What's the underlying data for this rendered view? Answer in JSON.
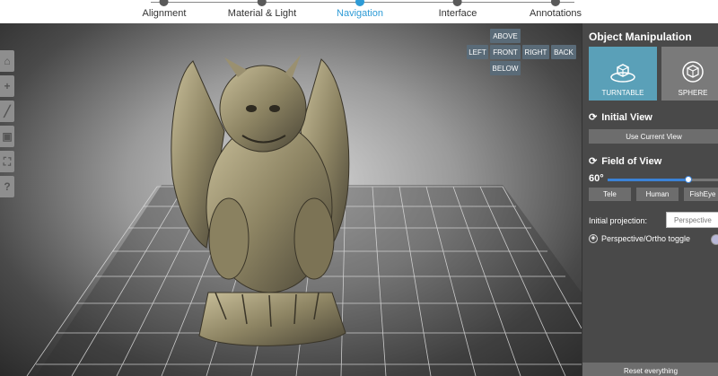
{
  "stepper": {
    "steps": [
      {
        "label": "Alignment"
      },
      {
        "label": "Material & Light"
      },
      {
        "label": "Navigation"
      },
      {
        "label": "Interface"
      },
      {
        "label": "Annotations"
      }
    ],
    "active": "Navigation"
  },
  "viewport": {
    "view_buttons": {
      "above": "ABOVE",
      "left": "LEFT",
      "front": "FRONT",
      "right": "RIGHT",
      "back": "BACK",
      "below": "BELOW"
    },
    "toolbar_icons": [
      "home-icon",
      "zoom-in-icon",
      "measure-icon",
      "cube-icon",
      "fullscreen-icon",
      "help-icon"
    ]
  },
  "panel": {
    "title": "Object Manipulation",
    "modes": [
      {
        "label": "TURNTABLE",
        "icon": "turntable-icon",
        "selected": true
      },
      {
        "label": "SPHERE",
        "icon": "sphere-icon",
        "selected": false
      }
    ],
    "initial_view": {
      "title": "Initial View",
      "button": "Use Current View"
    },
    "fov": {
      "title": "Field of View",
      "value_label": "60°",
      "value": 60,
      "presets": [
        "Tele",
        "Human",
        "FishEye"
      ]
    },
    "projection": {
      "label": "Initial projection:",
      "selected": "Perspective"
    },
    "toggle": {
      "label": "Perspective/Ortho toggle"
    },
    "reset_button": "Reset everything"
  },
  "colors": {
    "accent": "#2e9bd6",
    "tile_selected": "#5aa0b8",
    "panel_bg": "#494949",
    "slider": "#3b82d6"
  }
}
